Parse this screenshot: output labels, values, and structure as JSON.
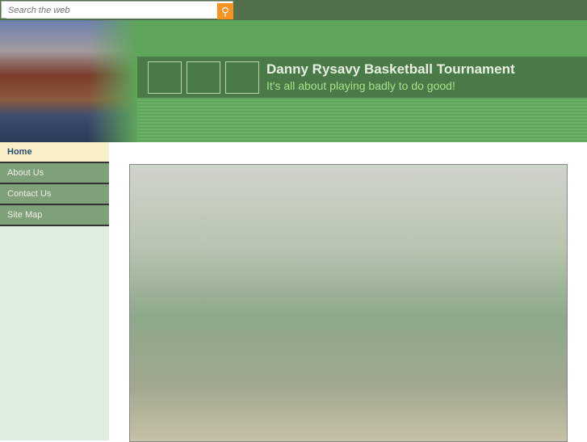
{
  "search": {
    "placeholder": "Search the web",
    "icon": "search-icon"
  },
  "header": {
    "title": "Danny Rysavy Basketball Tournament",
    "tagline": "It's all about playing badly to do good!"
  },
  "nav": {
    "items": [
      {
        "label": "Home"
      },
      {
        "label": "About Us"
      },
      {
        "label": "Contact Us"
      },
      {
        "label": "Site Map"
      }
    ]
  },
  "colors": {
    "accent": "#5fa55a",
    "search_button": "#f7931e"
  }
}
